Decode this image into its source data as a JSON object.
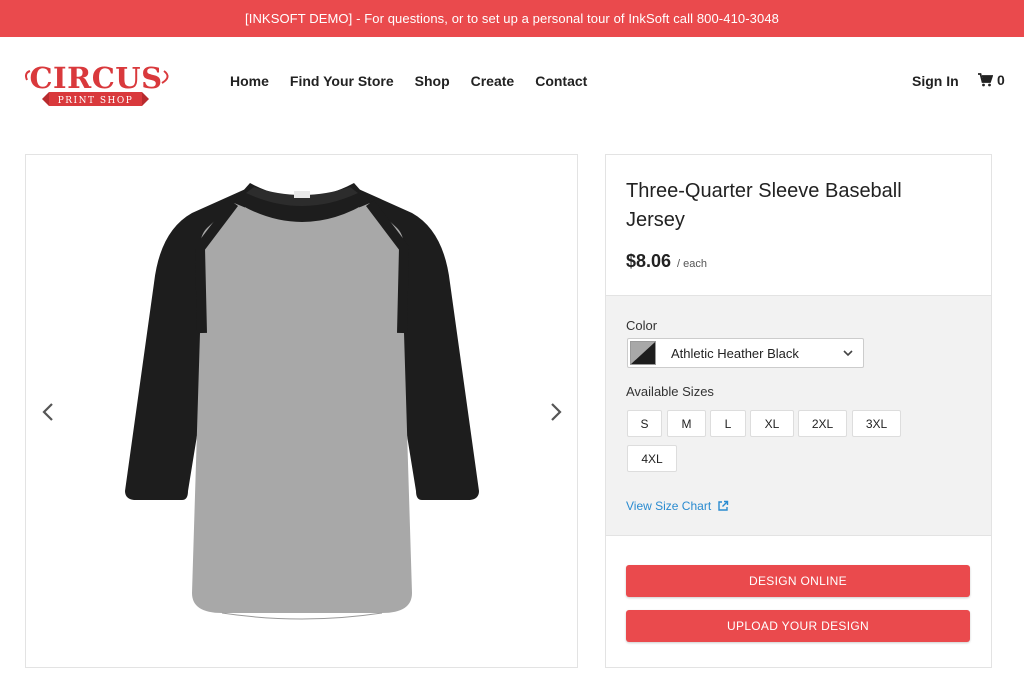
{
  "banner": {
    "text": "[INKSOFT DEMO] - For questions, or to set up a personal tour of InkSoft call 800-410-3048"
  },
  "logo": {
    "name": "CIRCUS",
    "sub": "PRINT SHOP"
  },
  "nav": {
    "items": [
      "Home",
      "Find Your Store",
      "Shop",
      "Create",
      "Contact"
    ]
  },
  "header": {
    "sign_in": "Sign In",
    "cart_count": "0"
  },
  "product": {
    "title": "Three-Quarter Sleeve Baseball Jersey",
    "price": "$8.06",
    "price_unit": "/ each",
    "color_label": "Color",
    "selected_color": "Athletic Heather Black",
    "sizes_label": "Available Sizes",
    "sizes": [
      "S",
      "M",
      "L",
      "XL",
      "2XL",
      "3XL",
      "4XL"
    ],
    "size_chart": "View Size Chart",
    "design_online": "DESIGN ONLINE",
    "upload_design": "UPLOAD YOUR DESIGN"
  },
  "colors": {
    "accent": "#ea4a4d",
    "link": "#2a8bd0",
    "options_bg": "#f2f2f2"
  },
  "icons": {
    "cart": "cart-icon",
    "prev": "chevron-left-icon",
    "next": "chevron-right-icon",
    "select": "chevron-down-icon",
    "external": "external-link-icon"
  }
}
